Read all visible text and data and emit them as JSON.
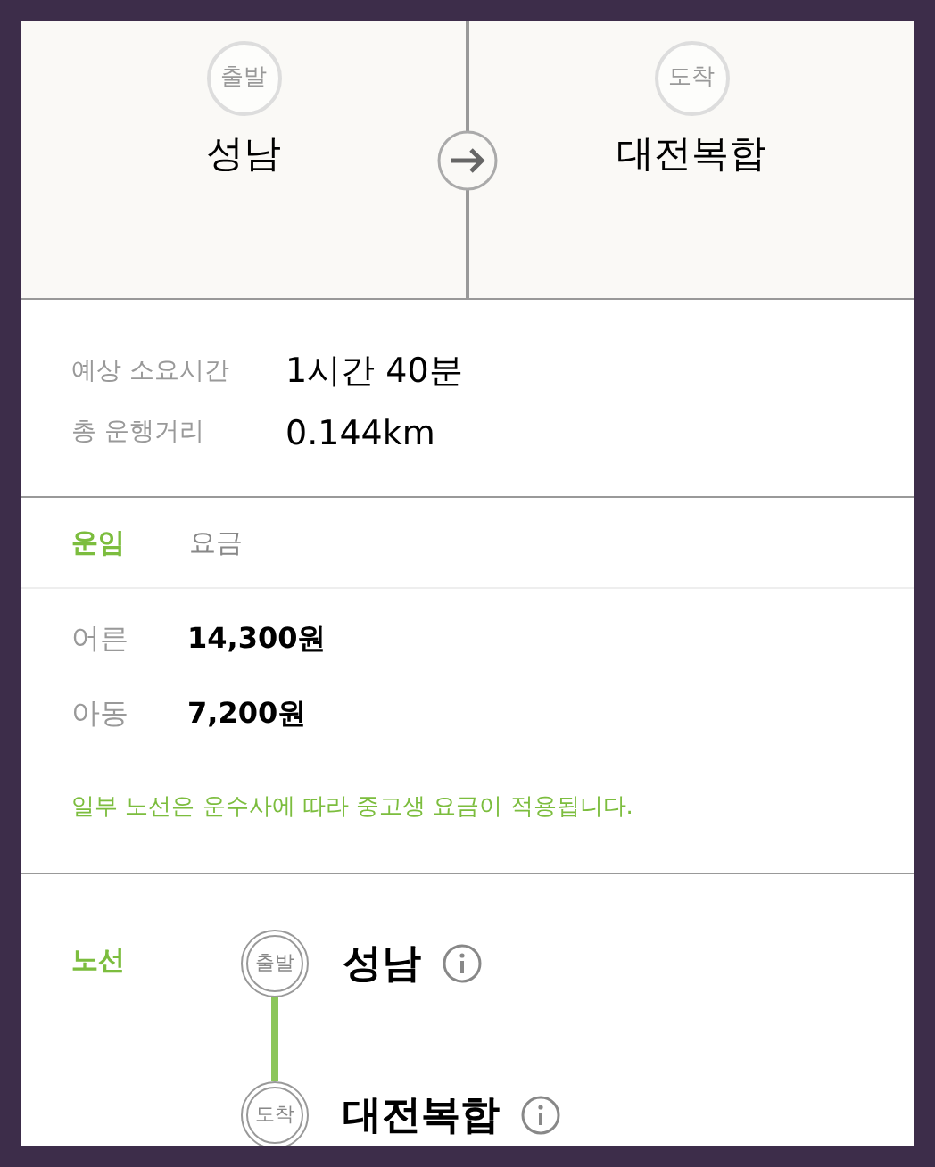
{
  "trip": {
    "departure": {
      "badge": "출발",
      "name": "성남"
    },
    "arrival": {
      "badge": "도착",
      "name": "대전복합"
    }
  },
  "summary": [
    {
      "label": "예상 소요시간",
      "value": "1시간 40분"
    },
    {
      "label": "총 운행거리",
      "value": "0.144km"
    }
  ],
  "fare_tabs": [
    {
      "label": "운임",
      "selected": true
    },
    {
      "label": "요금",
      "selected": false
    }
  ],
  "fares": [
    {
      "label": "어른",
      "value": "14,300원"
    },
    {
      "label": "아동",
      "value": "7,200원"
    }
  ],
  "fare_note": "일부 노선은 운수사에 따라 중고생 요금이 적용됩니다.",
  "route": {
    "label": "노선",
    "stops": [
      {
        "badge": "출발",
        "name": "성남"
      },
      {
        "badge": "도착",
        "name": "대전복합"
      }
    ]
  }
}
